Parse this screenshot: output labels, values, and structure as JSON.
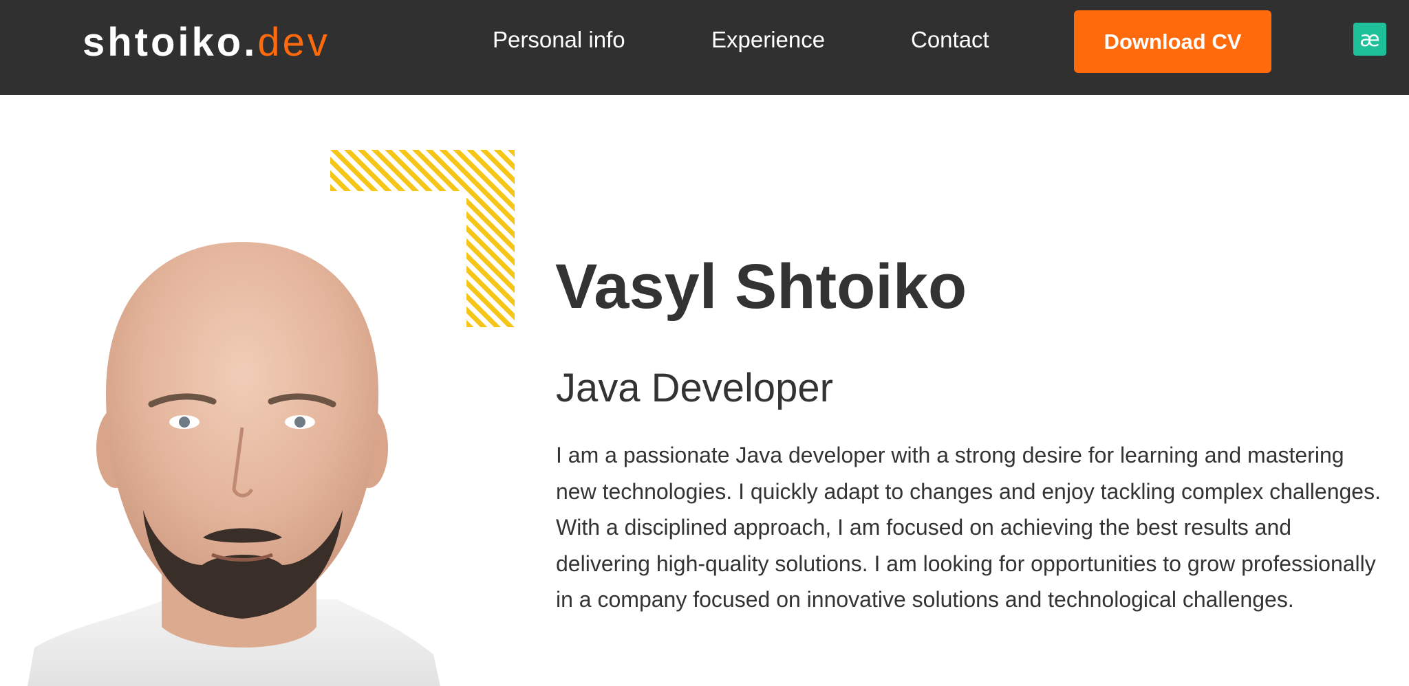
{
  "header": {
    "logo_main": "shtoiko.",
    "logo_accent": "dev",
    "nav": [
      {
        "label": "Personal info"
      },
      {
        "label": "Experience"
      },
      {
        "label": "Contact"
      }
    ],
    "cta_label": "Download CV",
    "extension_icon": {
      "glyph": "æ",
      "icon": "extension-ae-icon"
    }
  },
  "colors": {
    "header_bg": "#303030",
    "accent": "#ff6a0d",
    "stripe": "#f5c518",
    "text": "#333333"
  },
  "profile": {
    "name": "Vasyl Shtoiko",
    "role": "Java Developer",
    "bio": "I am a passionate Java developer with a strong desire for learning and mastering new technologies. I quickly adapt to changes and enjoy tackling complex challenges. With a disciplined approach, I am focused on achieving the best results and delivering high-quality solutions. I am looking for opportunities to grow professionally in a company focused on innovative solutions and technological challenges."
  },
  "portrait": {
    "icon": "profile-photo"
  }
}
